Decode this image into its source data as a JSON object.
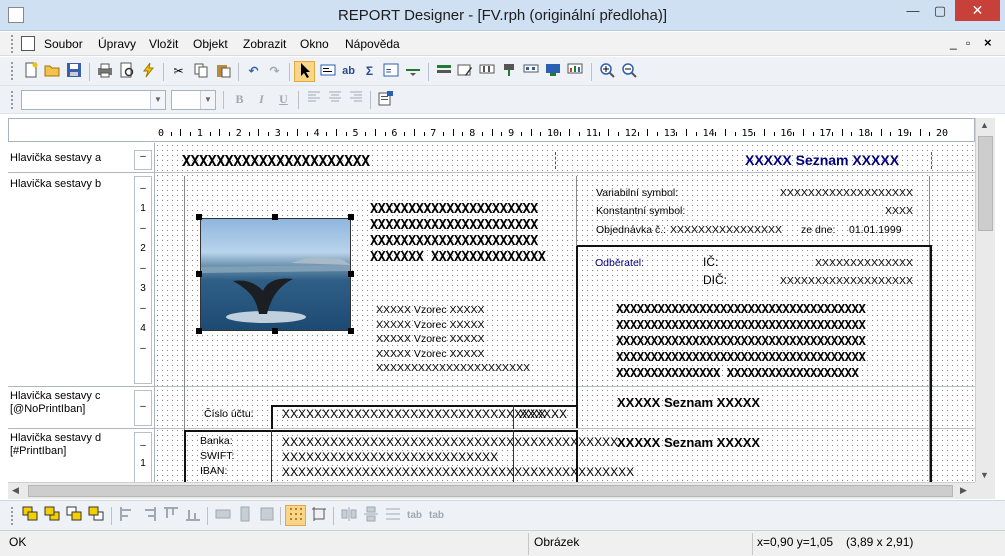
{
  "window": {
    "title": "REPORT Designer - [FV.rph (originální předloha)]",
    "minimize": "—",
    "maximize": "▢",
    "close": "✕",
    "mdi_controls": [
      "_",
      "▫",
      "×"
    ]
  },
  "menu": [
    "Soubor",
    "Úpravy",
    "Vložit",
    "Objekt",
    "Zobrazit",
    "Okno",
    "Nápověda"
  ],
  "format_toolbar": {
    "font_value": "",
    "size_value": "",
    "bold": "B",
    "italic": "I",
    "underline": "U"
  },
  "ruler": [
    "0",
    "1",
    "2",
    "3",
    "4",
    "5",
    "6",
    "7",
    "8",
    "9",
    "10",
    "11",
    "12",
    "13",
    "14",
    "15",
    "16",
    "17",
    "18",
    "19",
    "20"
  ],
  "sections": [
    {
      "label": "Hlavička sestavy a",
      "marks": [
        "–"
      ]
    },
    {
      "label": "Hlavička sestavy b",
      "marks": [
        "–",
        "1",
        "–",
        "2",
        "–",
        "3",
        "–",
        "4",
        "–"
      ]
    },
    {
      "label": "Hlavička sestavy c\n[@NoPrintIban]",
      "marks": [
        "–"
      ]
    },
    {
      "label": "Hlavička sestavy d\n[#PrintIban]",
      "marks": [
        "–",
        "1"
      ]
    }
  ],
  "report": {
    "header_left": "XXXXXXXXXXXXXXXXXXXXXX",
    "header_right": "XXXXX Seznam XXXXX",
    "supplier_lines": [
      "XXXXXXXXXXXXXXXXXXXXXX",
      "XXXXXXXXXXXXXXXXXXXXXX",
      "XXXXXXXXXXXXXXXXXXXXXX",
      "XXXXXXX XXXXXXXXXXXXXXX"
    ],
    "formula_lines": [
      "XXXXX Vzorec XXXXX",
      "XXXXX Vzorec XXXXX",
      "XXXXX Vzorec XXXXX",
      "XXXXX Vzorec XXXXX",
      "XXXXXXXXXXXXXXXXXXXXXX"
    ],
    "variable_symbol_label": "Variabilní symbol:",
    "variable_symbol_value": "XXXXXXXXXXXXXXXXXXX",
    "constant_symbol_label": "Konstantní symbol:",
    "constant_symbol_value": "XXXX",
    "order_label": "Objednávka č.:",
    "order_value": "XXXXXXXXXXXXXXXX",
    "order_date_label": "ze dne:",
    "order_date_value": "01.01.1999",
    "customer_label": "Odběratel:",
    "ic_label": "IČ:",
    "ic_value": "XXXXXXXXXXXXXX",
    "dic_label": "DIČ:",
    "dic_value": "XXXXXXXXXXXXXXXXXXX",
    "customer_lines": [
      "XXXXXXXXXXXXXXXXXXXXXXXXXXXXXXXXXXXX",
      "XXXXXXXXXXXXXXXXXXXXXXXXXXXXXXXXXXXX",
      "XXXXXXXXXXXXXXXXXXXXXXXXXXXXXXXXXXXX",
      "XXXXXXXXXXXXXXXXXXXXXXXXXXXXXXXXXXXX",
      "XXXXXXXXXXXXXXX XXXXXXXXXXXXXXXXXXX"
    ],
    "account_label": "Číslo účtu:",
    "account_value": "XXXXXXXXXXXXXXXXXXXXXXXXXXXXXXXXX",
    "account_code": "XXXXXX",
    "seznam_c": "XXXXX Seznam XXXXX",
    "bank_label": "Banka:",
    "bank_value": "XXXXXXXXXXXXXXXXXXXXXXXXXXXXXXXXXXXXXXXXXX",
    "swift_label": "SWIFT:",
    "swift_value": "XXXXXXXXXXXXXXXXXXXXXXXXXXX",
    "iban_label": "IBAN:",
    "iban_value": "XXXXXXXXXXXXXXXXXXXXXXXXXXXXXXXXXXXXXXXXXXXX",
    "seznam_d": "XXXXX Seznam XXXXX"
  },
  "bottom_toolbar": {
    "tab1": "tab",
    "tab2": "tab"
  },
  "status": {
    "message": "OK",
    "selection": "Obrázek",
    "position": "x=0,90  y=1,05",
    "size": "(3,89 x 2,91)"
  },
  "colors": {
    "titlebar": "#cfe0f2",
    "close": "#c7403a",
    "accent_blue": "#00007f",
    "marker_red": "#d02020"
  }
}
